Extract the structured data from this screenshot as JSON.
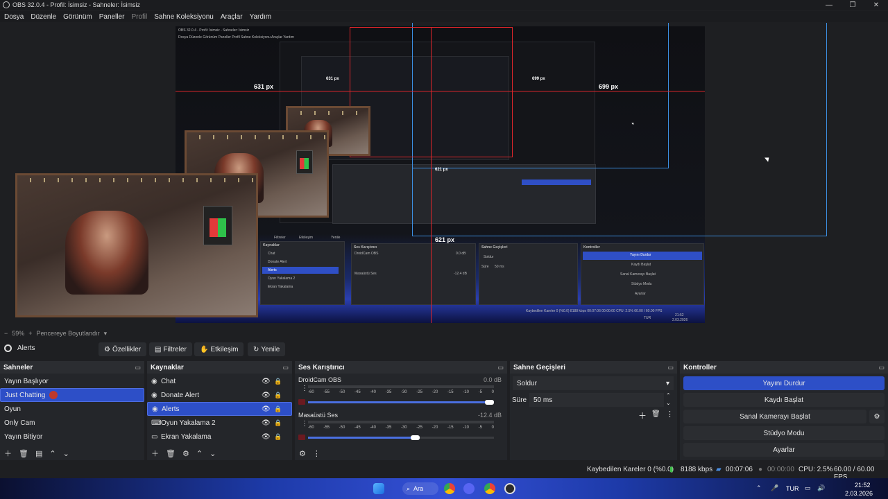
{
  "window": {
    "title": "OBS 32.0.4 - Profil: İsimsiz - Sahneler: İsimsiz",
    "controls": [
      "—",
      "❐",
      "✕"
    ]
  },
  "menu": [
    "Dosya",
    "Düzenle",
    "Görünüm",
    "Paneller",
    "Profil",
    "Sahne Koleksiyonu",
    "Araçlar",
    "Yardım"
  ],
  "preview": {
    "labels": {
      "left": "631 px",
      "right": "699 px",
      "bottom": "621 px",
      "nested_left": "631 px",
      "nested_right": "699 px",
      "nested_bottom": "621 px"
    },
    "nested_title": "OBS 32.0.4 - Profil: İsimsiz - Sahneler: İsimsiz",
    "nested_menu": [
      "Dosya",
      "Düzenle",
      "Görünüm",
      "Paneller",
      "Profil",
      "Sahne Koleksiyonu",
      "Araçlar",
      "Yardım"
    ],
    "nested_sources": [
      "Chat",
      "Donate Alert",
      "Alerts",
      "Oyun Yakalama 2",
      "Ekran Yakalama"
    ],
    "nested_buttons": [
      "Filtreler",
      "Etkileşim",
      "Yenile"
    ],
    "nested_mixer": {
      "title": "Ses Karıştırıcı",
      "ch1": "DroidCam OBS",
      "ch1_db": "0.0 dB",
      "ch2": "Masaüstü Ses",
      "ch2_db": "-12.4 dB"
    },
    "nested_transitions": {
      "title": "Sahne Geçişleri",
      "transition": "Soldur",
      "duration_label": "Süre",
      "duration": "50 ms"
    },
    "nested_controls": {
      "title": "Kontroller",
      "buttons": [
        "Yayını Durdur",
        "Kaydı Başlat",
        "Sanal Kamerayı Başlat",
        "Stüdyo Modu",
        "Ayarlar"
      ]
    },
    "nested_status": "Kaybedilen Kareler 0 (%0.0)   8188 kbps   00:07:06   00:00:00   CPU: 2.5%   60.00 / 60.00 FPS",
    "nested_time": "21:52",
    "nested_date": "2.03.2026",
    "nested_lang": "TUR"
  },
  "preview_bar": {
    "zoom": "59%",
    "mode": "Pencereye Boyutlandır"
  },
  "source_toolbar": {
    "selected_source": "Alerts",
    "properties": "Özellikler",
    "filters": "Filtreler",
    "interact": "Etkileşim",
    "refresh": "Yenile"
  },
  "scenes": {
    "title": "Sahneler",
    "items": [
      "Yayın Başlıyor",
      "Just Chatting",
      "Oyun",
      "Only Cam",
      "Yayın Bitiyor"
    ],
    "selected": 1
  },
  "sources": {
    "title": "Kaynaklar",
    "items": [
      "Chat",
      "Donate Alert",
      "Alerts",
      "Oyun Yakalama 2",
      "Ekran Yakalama"
    ],
    "selected": 2
  },
  "mixer": {
    "title": "Ses Karıştırıcı",
    "channels": [
      {
        "name": "DroidCam OBS",
        "db": "0.0 dB",
        "volume": 1.0
      },
      {
        "name": "Masaüstü Ses",
        "db": "-12.4 dB",
        "volume": 0.6
      }
    ],
    "scale": [
      "-60",
      "-55",
      "-50",
      "-45",
      "-40",
      "-35",
      "-30",
      "-25",
      "-20",
      "-15",
      "-10",
      "-5",
      "0"
    ]
  },
  "transitions": {
    "title": "Sahne Geçişleri",
    "transition": "Soldur",
    "duration_label": "Süre",
    "duration": "50 ms"
  },
  "controls": {
    "title": "Kontroller",
    "stream": "Yayını Durdur",
    "record": "Kaydı Başlat",
    "virtualcam": "Sanal Kamerayı Başlat",
    "studio": "Stüdyo Modu",
    "settings": "Ayarlar"
  },
  "status": {
    "dropped": "Kaybedilen Kareler 0 (%0.0)",
    "bitrate": "8188 kbps",
    "stream_time": "00:07:06",
    "record_time": "00:00:00",
    "cpu": "CPU: 2.5%",
    "fps": "60.00 / 60.00 FPS"
  },
  "taskbar": {
    "search": "Ara",
    "lang": "TUR",
    "time": "21:52",
    "date": "2.03.2026"
  },
  "colors": {
    "accent": "#2d4fc7",
    "guide": "#e0262b",
    "guide_blue": "#3b8ee0",
    "panel": "#24262a"
  }
}
